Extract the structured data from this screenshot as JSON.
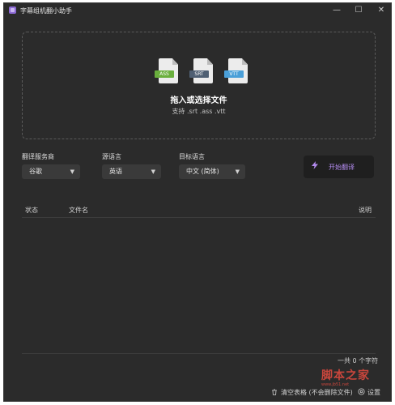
{
  "window": {
    "title": "字幕组机翻小助手",
    "minimize": "—",
    "maximize": "☐",
    "close": "✕"
  },
  "drop_zone": {
    "title": "拖入或选择文件",
    "subtitle": "支持 .srt .ass .vtt",
    "icons": [
      {
        "label": "ASS",
        "color": "#6aaf3d",
        "icon": "ass-file-icon"
      },
      {
        "label": "SRT",
        "color": "#4f5f73",
        "icon": "srt-file-icon"
      },
      {
        "label": "VTT",
        "color": "#4a9fd8",
        "icon": "vtt-file-icon"
      }
    ]
  },
  "options": {
    "service_label": "翻译服务商",
    "service_value": "谷歌",
    "source_label": "源语言",
    "source_value": "英语",
    "target_label": "目标语言",
    "target_value": "中文 (简体)",
    "caret": "▼"
  },
  "start_button": {
    "label": "开始翻译",
    "icon": "lightning-icon",
    "accent": "#b48cf0"
  },
  "table": {
    "columns": [
      "状态",
      "文件名",
      "说明"
    ],
    "rows": []
  },
  "footer": {
    "count_text": "一共 0 个字符",
    "clear_label": "清空表格 (不会删除文件)",
    "settings_label": "设置"
  },
  "watermark": {
    "main": "脚本之家",
    "sub": "www.jb51.net"
  }
}
